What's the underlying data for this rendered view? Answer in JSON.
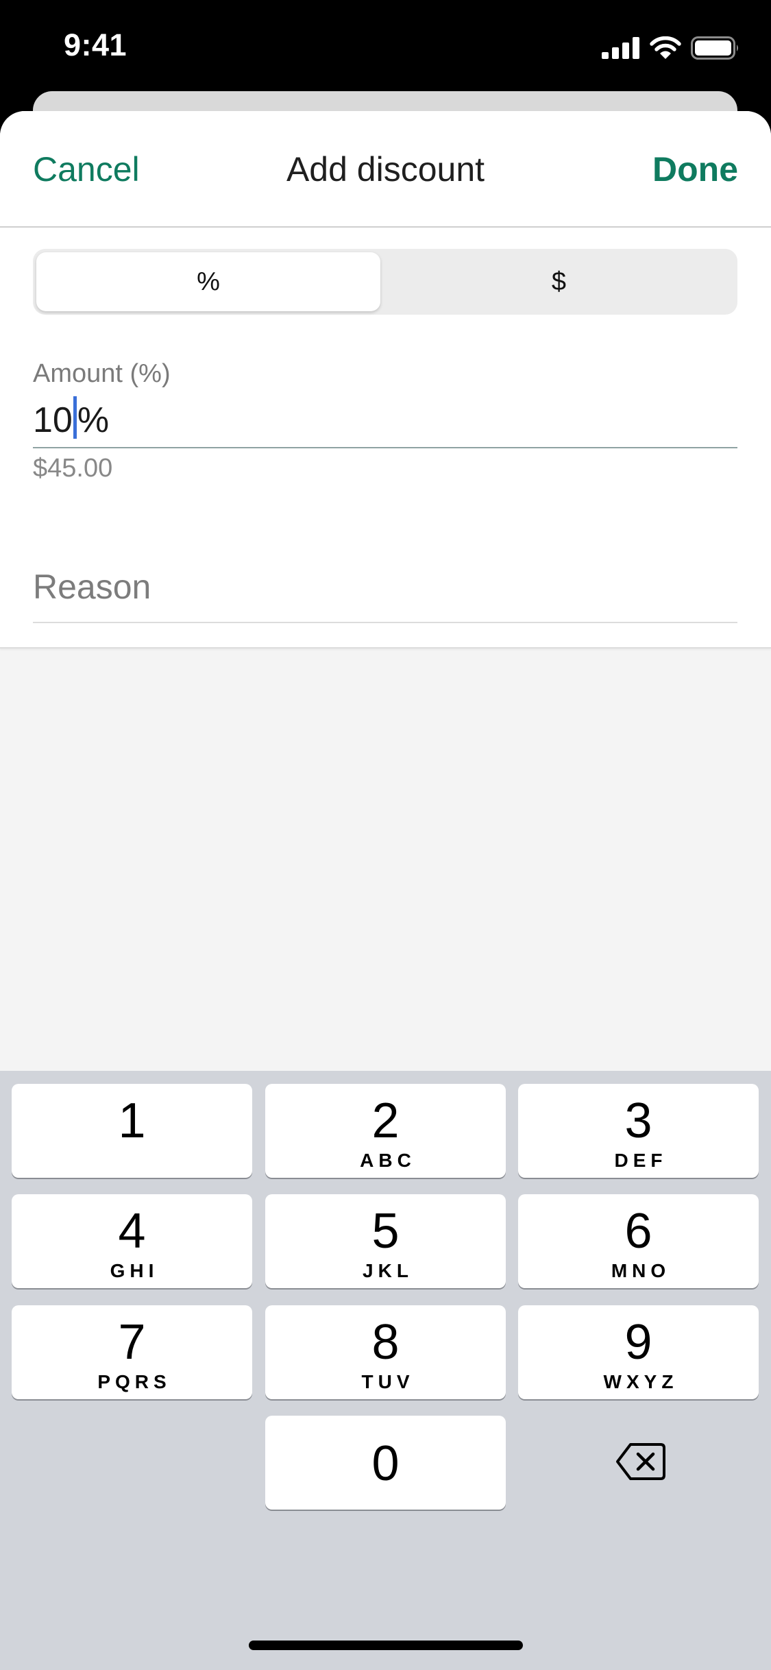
{
  "status_bar": {
    "time": "9:41"
  },
  "nav": {
    "cancel_label": "Cancel",
    "title": "Add discount",
    "done_label": "Done"
  },
  "discount_type": {
    "options": [
      "%",
      "$"
    ],
    "selected": "%"
  },
  "amount": {
    "label": "Amount (%)",
    "value_before_cursor": "10",
    "value_after_cursor": "%",
    "computed_hint": "$45.00"
  },
  "reason": {
    "placeholder": "Reason"
  },
  "keypad": {
    "keys": [
      {
        "digit": "1",
        "letters": ""
      },
      {
        "digit": "2",
        "letters": "ABC"
      },
      {
        "digit": "3",
        "letters": "DEF"
      },
      {
        "digit": "4",
        "letters": "GHI"
      },
      {
        "digit": "5",
        "letters": "JKL"
      },
      {
        "digit": "6",
        "letters": "MNO"
      },
      {
        "digit": "7",
        "letters": "PQRS"
      },
      {
        "digit": "8",
        "letters": "TUV"
      },
      {
        "digit": "9",
        "letters": "WXYZ"
      },
      {
        "digit": "0",
        "letters": ""
      }
    ]
  },
  "colors": {
    "accent": "#0f7b5f",
    "cursor": "#3a6fd8",
    "keyboard_bg": "#d1d4da"
  },
  "icons": [
    "signal-icon",
    "wifi-icon",
    "battery-icon",
    "delete-backspace-icon"
  ]
}
